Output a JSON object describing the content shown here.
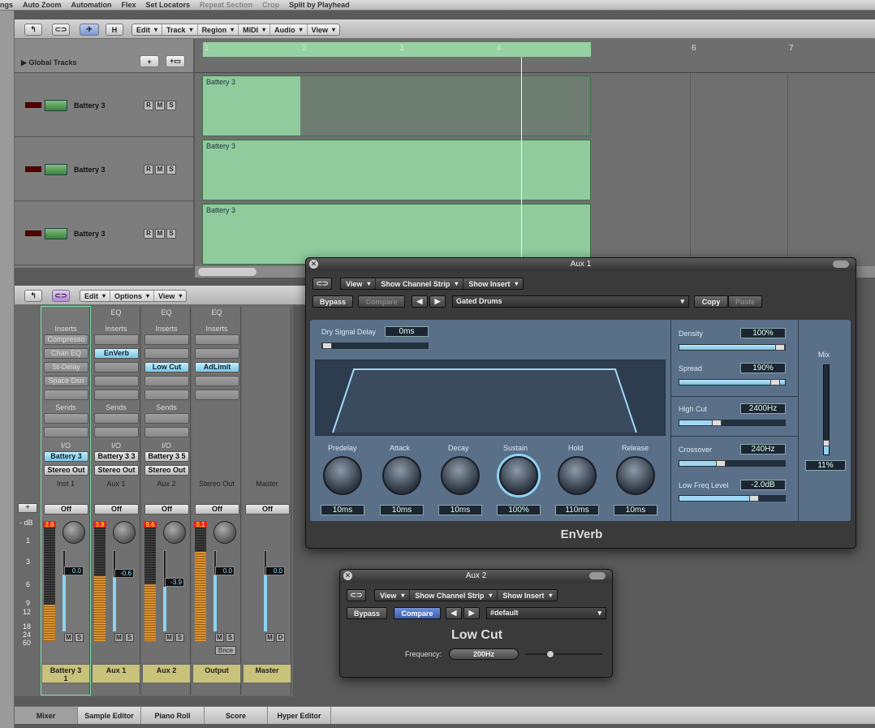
{
  "top_toolbar": {
    "items": [
      "ngs",
      "Auto Zoom",
      "Automation",
      "Flex",
      "Set Locators",
      "Repeat Section",
      "Crop",
      "Split by Playhead"
    ]
  },
  "arrange_toolbar": {
    "h_label": "H",
    "menus": [
      "Edit",
      "Track",
      "Region",
      "MIDI",
      "Audio",
      "View"
    ]
  },
  "global_tracks": {
    "label": "Global Tracks"
  },
  "ruler": {
    "numbers": [
      "1",
      "2",
      "3",
      "4",
      "6",
      "7"
    ]
  },
  "tracks": [
    {
      "name": "Battery 3",
      "region": "Battery 3",
      "rms": [
        "R",
        "M",
        "S"
      ]
    },
    {
      "name": "Battery 3",
      "region": "Battery 3",
      "rms": [
        "R",
        "M",
        "S"
      ]
    },
    {
      "name": "Battery 3",
      "region": "Battery 3",
      "rms": [
        "R",
        "M",
        "S"
      ]
    }
  ],
  "mixer_toolbar": {
    "menus": [
      "Edit",
      "Options",
      "View"
    ]
  },
  "mixer": {
    "db_label": "- dB",
    "db_scale": [
      "1",
      "3",
      "6",
      "9",
      "12",
      "18",
      "24",
      "60"
    ],
    "section_labels": {
      "eq": "EQ",
      "inserts": "Inserts",
      "sends": "Sends",
      "io": "I/O",
      "off": "Off"
    },
    "strips": [
      {
        "inserts": [
          "Compresso",
          "Chan EQ",
          "St-Delay",
          "Space Dsn"
        ],
        "input": "Battery 3",
        "output": "Stereo Out",
        "label": "Inst 1",
        "peak": "2.6",
        "fader": "0.0",
        "name": "Battery 3",
        "name2": "1"
      },
      {
        "inserts": [
          "EnVerb"
        ],
        "input": "Battery 3 3",
        "output": "Stereo Out",
        "label": "Aux 1",
        "peak": "3.8",
        "fader": "-0.6",
        "name": "Aux 1"
      },
      {
        "inserts": [
          "Low Cut"
        ],
        "input": "Battery 3 5",
        "output": "Stereo Out",
        "label": "Aux 2",
        "peak": "9.6",
        "fader": "-3.9",
        "name": "Aux 2"
      },
      {
        "inserts": [
          "AdLimit"
        ],
        "label": "Stereo Out",
        "peak": "0.1",
        "fader": "0.0",
        "name": "Output",
        "bnce": "Bnce"
      },
      {
        "label": "Master",
        "fader": "0.0",
        "name": "Master"
      }
    ]
  },
  "bottom_tabs": [
    "Mixer",
    "Sample Editor",
    "Piano Roll",
    "Score",
    "Hyper Editor"
  ],
  "aux1": {
    "title": "Aux 1",
    "menus": [
      "View",
      "Show Channel Strip",
      "Show Insert"
    ],
    "bypass": "Bypass",
    "compare": "Compare",
    "preset": "Gated Drums",
    "copy": "Copy",
    "paste": "Paste",
    "dry_delay_label": "Dry Signal Delay",
    "dry_delay": "0ms",
    "knobs": [
      {
        "label": "Predelay",
        "value": "10ms"
      },
      {
        "label": "Attack",
        "value": "10ms"
      },
      {
        "label": "Decay",
        "value": "10ms"
      },
      {
        "label": "Sustain",
        "value": "100%"
      },
      {
        "label": "Hold",
        "value": "110ms"
      },
      {
        "label": "Release",
        "value": "10ms"
      }
    ],
    "params": [
      {
        "label": "Density",
        "value": "100%",
        "level": 0.97
      },
      {
        "label": "Spread",
        "value": "190%",
        "level": 0.95
      },
      {
        "label": "High Cut",
        "value": "2400Hz",
        "level": 0.35
      },
      {
        "label": "Crossover",
        "value": "240Hz",
        "level": 0.39
      },
      {
        "label": "Low Freq Level",
        "value": "-2.0dB",
        "level": 0.7
      }
    ],
    "mix_label": "Mix",
    "mix_value": "11%",
    "plugin_name": "EnVerb"
  },
  "aux2": {
    "title": "Aux 2",
    "menus": [
      "View",
      "Show Channel Strip",
      "Show Insert"
    ],
    "bypass": "Bypass",
    "compare": "Compare",
    "preset": "#default",
    "plugin_name": "Low Cut",
    "freq_label": "Frequency:",
    "freq_value": "200Hz"
  }
}
